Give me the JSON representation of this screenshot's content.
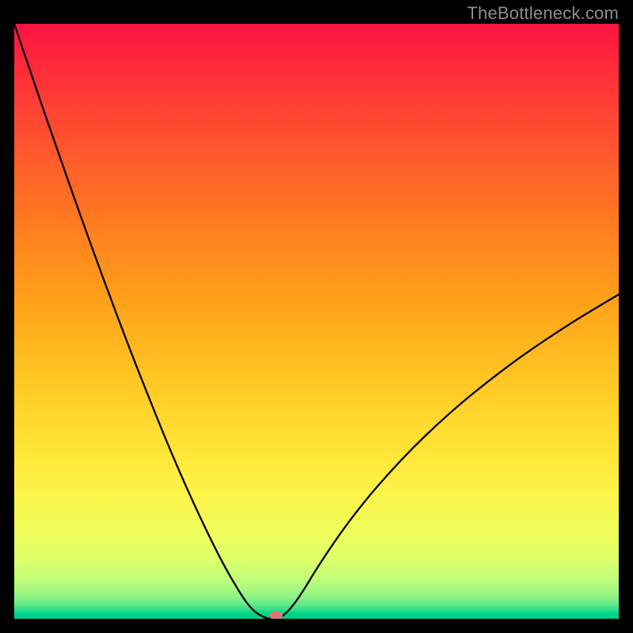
{
  "watermark": "TheBottleneck.com",
  "chart_data": {
    "type": "line",
    "title": "",
    "xlabel": "",
    "ylabel": "",
    "xlim": [
      0,
      100
    ],
    "ylim": [
      0,
      100
    ],
    "grid": false,
    "legend": false,
    "notch": {
      "x": 42,
      "y": 0
    },
    "marker": {
      "x": 43.3,
      "y": 0,
      "color": "#d87a74"
    },
    "series": [
      {
        "name": "curve",
        "color": "#000000",
        "x": [
          0,
          2,
          4,
          6,
          8,
          10,
          12,
          14,
          16,
          18,
          20,
          22,
          24,
          26,
          28,
          30,
          32,
          34,
          36,
          38,
          39,
          40,
          41,
          42,
          44,
          46,
          48,
          50,
          54,
          58,
          62,
          66,
          70,
          74,
          78,
          82,
          86,
          90,
          94,
          98,
          100
        ],
        "y": [
          100,
          94.0,
          88.0,
          82.1,
          76.3,
          70.5,
          64.8,
          59.2,
          53.7,
          48.3,
          43.0,
          37.9,
          32.8,
          27.9,
          23.2,
          18.7,
          14.4,
          10.3,
          6.6,
          3.3,
          2.0,
          1.0,
          0.4,
          0.0,
          0.0,
          2.0,
          5.0,
          8.4,
          14.5,
          19.8,
          24.5,
          28.8,
          32.7,
          36.3,
          39.6,
          42.7,
          45.6,
          48.3,
          50.9,
          53.3,
          54.5
        ]
      }
    ],
    "gradient_stops": [
      {
        "offset": 0.0,
        "color": "#fb1440"
      },
      {
        "offset": 0.021,
        "color": "#fc1a3f"
      },
      {
        "offset": 0.041,
        "color": "#fd213d"
      },
      {
        "offset": 0.062,
        "color": "#fe283b"
      },
      {
        "offset": 0.082,
        "color": "#fe2e39"
      },
      {
        "offset": 0.103,
        "color": "#ff3537"
      },
      {
        "offset": 0.124,
        "color": "#ff3b35"
      },
      {
        "offset": 0.144,
        "color": "#ff4233"
      },
      {
        "offset": 0.165,
        "color": "#ff4831"
      },
      {
        "offset": 0.185,
        "color": "#ff4e2f"
      },
      {
        "offset": 0.206,
        "color": "#ff542d"
      },
      {
        "offset": 0.226,
        "color": "#ff5b2b"
      },
      {
        "offset": 0.247,
        "color": "#ff6129"
      },
      {
        "offset": 0.268,
        "color": "#ff6727"
      },
      {
        "offset": 0.288,
        "color": "#ff6d25"
      },
      {
        "offset": 0.309,
        "color": "#ff7323"
      },
      {
        "offset": 0.329,
        "color": "#ff7921"
      },
      {
        "offset": 0.35,
        "color": "#ff8020"
      },
      {
        "offset": 0.371,
        "color": "#ff861e"
      },
      {
        "offset": 0.391,
        "color": "#ff8c1d"
      },
      {
        "offset": 0.412,
        "color": "#ff921c"
      },
      {
        "offset": 0.432,
        "color": "#ff971b"
      },
      {
        "offset": 0.453,
        "color": "#ff9d1b"
      },
      {
        "offset": 0.474,
        "color": "#ffa31b"
      },
      {
        "offset": 0.494,
        "color": "#ffa91c"
      },
      {
        "offset": 0.515,
        "color": "#ffaf1c"
      },
      {
        "offset": 0.535,
        "color": "#ffb51e"
      },
      {
        "offset": 0.556,
        "color": "#ffbb20"
      },
      {
        "offset": 0.576,
        "color": "#ffc022"
      },
      {
        "offset": 0.597,
        "color": "#ffc624"
      },
      {
        "offset": 0.618,
        "color": "#ffcb26"
      },
      {
        "offset": 0.638,
        "color": "#ffd129"
      },
      {
        "offset": 0.659,
        "color": "#ffd62d"
      },
      {
        "offset": 0.679,
        "color": "#ffdb30"
      },
      {
        "offset": 0.7,
        "color": "#ffe034"
      },
      {
        "offset": 0.721,
        "color": "#ffe538"
      },
      {
        "offset": 0.741,
        "color": "#ffea3d"
      },
      {
        "offset": 0.762,
        "color": "#feee42"
      },
      {
        "offset": 0.782,
        "color": "#fcf247"
      },
      {
        "offset": 0.803,
        "color": "#faf64c"
      },
      {
        "offset": 0.824,
        "color": "#f6f952"
      },
      {
        "offset": 0.844,
        "color": "#f2fc58"
      },
      {
        "offset": 0.865,
        "color": "#ecfe5f"
      },
      {
        "offset": 0.875,
        "color": "#e8ff62"
      },
      {
        "offset": 0.885,
        "color": "#e4ff66"
      },
      {
        "offset": 0.895,
        "color": "#dfff69"
      },
      {
        "offset": 0.905,
        "color": "#d9ff6d"
      },
      {
        "offset": 0.915,
        "color": "#d1ff71"
      },
      {
        "offset": 0.925,
        "color": "#c8fe75"
      },
      {
        "offset": 0.935,
        "color": "#bdfd79"
      },
      {
        "offset": 0.945,
        "color": "#affa7d"
      },
      {
        "offset": 0.955,
        "color": "#9ef781"
      },
      {
        "offset": 0.965,
        "color": "#87f285"
      },
      {
        "offset": 0.975,
        "color": "#66eb88"
      },
      {
        "offset": 0.985,
        "color": "#2ddf8b"
      },
      {
        "offset": 0.992,
        "color": "#00d48c"
      },
      {
        "offset": 1.0,
        "color": "#00c98c"
      }
    ]
  }
}
